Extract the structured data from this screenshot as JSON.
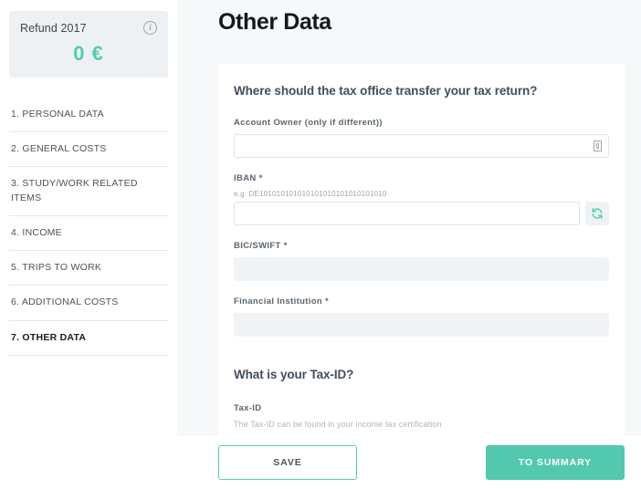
{
  "sidebar": {
    "refund": {
      "label": "Refund 2017",
      "amount": "0 €",
      "info_icon": "info-icon",
      "accent_color": "#4ecdb0",
      "card_bg": "#edf1f4"
    },
    "items": [
      {
        "label": "1. PERSONAL DATA",
        "active": false
      },
      {
        "label": "2. GENERAL COSTS",
        "active": false
      },
      {
        "label": "3. STUDY/WORK RELATED ITEMS",
        "active": false
      },
      {
        "label": "4. INCOME",
        "active": false
      },
      {
        "label": "5. TRIPS TO WORK",
        "active": false
      },
      {
        "label": "6. ADDITIONAL COSTS",
        "active": false
      },
      {
        "label": "7. OTHER DATA",
        "active": true
      }
    ]
  },
  "main": {
    "title": "Other Data",
    "sections": [
      {
        "heading": "Where should the tax office transfer your tax return?"
      },
      {
        "heading": "What is your Tax-ID?"
      }
    ],
    "fields": {
      "account_owner": {
        "label": "Account Owner (only if different))",
        "value": "",
        "placeholder": "",
        "icon": "id-card-icon"
      },
      "iban": {
        "label": "IBAN *",
        "hint": "e.g. DE101010101010101010101010101010",
        "value": "",
        "placeholder": "",
        "refresh_icon": "refresh-icon"
      },
      "bic_swift": {
        "label": "BIC/SWIFT *",
        "value": "",
        "placeholder": "",
        "disabled": true
      },
      "financial_institution": {
        "label": "Financial Institution *",
        "value": "",
        "placeholder": "",
        "disabled": true
      },
      "tax_id": {
        "label": "Tax-ID",
        "sub": "The Tax-ID can be found in your income tax certification"
      }
    }
  },
  "bottom_bar": {
    "save_label": "SAVE",
    "summary_label": "TO SUMMARY",
    "accent_color": "#52c9ae"
  }
}
